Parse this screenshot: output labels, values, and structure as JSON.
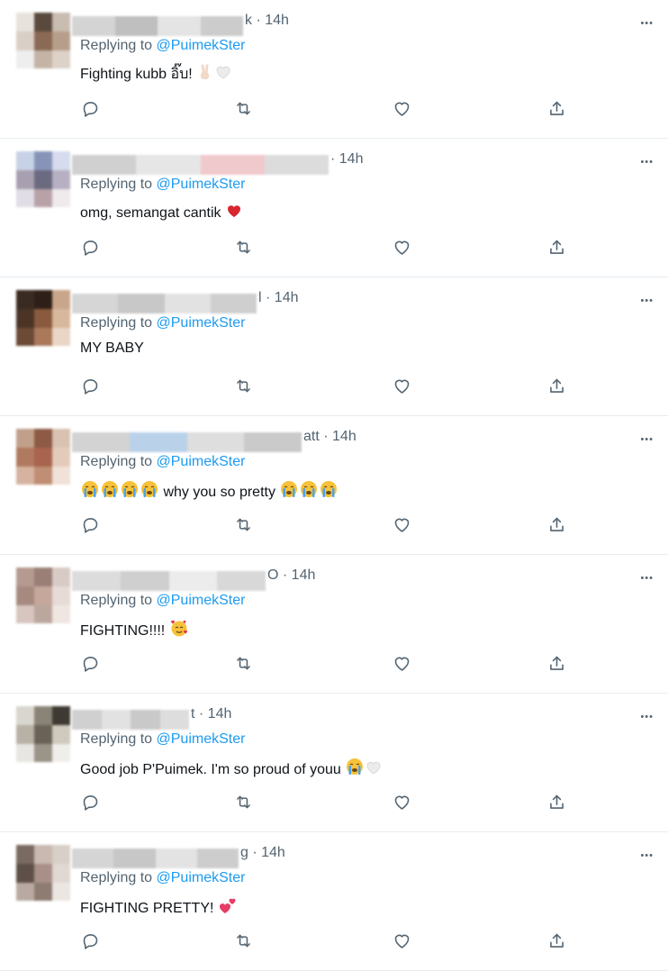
{
  "tweets": [
    {
      "name_tail": "k",
      "time": "· 14h",
      "reply_prefix": "Replying to",
      "handle": "@PuimekSter",
      "text": "Fighting kubb อิ๊บ!",
      "emojis": [
        "victory-hand",
        "white-heart"
      ]
    },
    {
      "name_tail": "",
      "time": "· 14h",
      "reply_prefix": "Replying to",
      "handle": "@PuimekSter",
      "text": "omg, semangat cantik",
      "emojis": [
        "red-heart"
      ]
    },
    {
      "name_tail": "l",
      "time": "· 14h",
      "reply_prefix": "Replying to",
      "handle": "@PuimekSter",
      "text": "MY BABY",
      "emojis": []
    },
    {
      "name_tail": "att",
      "time": "· 14h",
      "reply_prefix": "Replying to",
      "handle": "@PuimekSter",
      "text": "why you so pretty",
      "emojis": [
        "crying-face",
        "crying-face",
        "crying-face",
        "crying-face",
        "crying-face",
        "crying-face",
        "crying-face"
      ]
    },
    {
      "name_tail": "O",
      "time": "· 14h",
      "reply_prefix": "Replying to",
      "handle": "@PuimekSter",
      "text": "FIGHTING!!!!",
      "emojis": [
        "smiling-face-with-hearts"
      ]
    },
    {
      "name_tail": "t",
      "time": "· 14h",
      "reply_prefix": "Replying to",
      "handle": "@PuimekSter",
      "text": "Good job P'Puimek. I'm so proud of youu",
      "emojis": [
        "crying-face",
        "white-heart"
      ]
    },
    {
      "name_tail": "g",
      "time": "· 14h",
      "reply_prefix": "Replying to",
      "handle": "@PuimekSter",
      "text": "FIGHTING PRETTY!",
      "emojis": [
        "two-hearts"
      ]
    }
  ],
  "icons": {
    "more": "more-horizontal-icon",
    "reply": "reply-icon",
    "retweet": "retweet-icon",
    "like": "heart-icon",
    "share": "share-icon"
  },
  "colors": {
    "link": "#1d9bf0",
    "secondary": "#536471",
    "text": "#0f1419",
    "divider": "#e6ecf0"
  }
}
